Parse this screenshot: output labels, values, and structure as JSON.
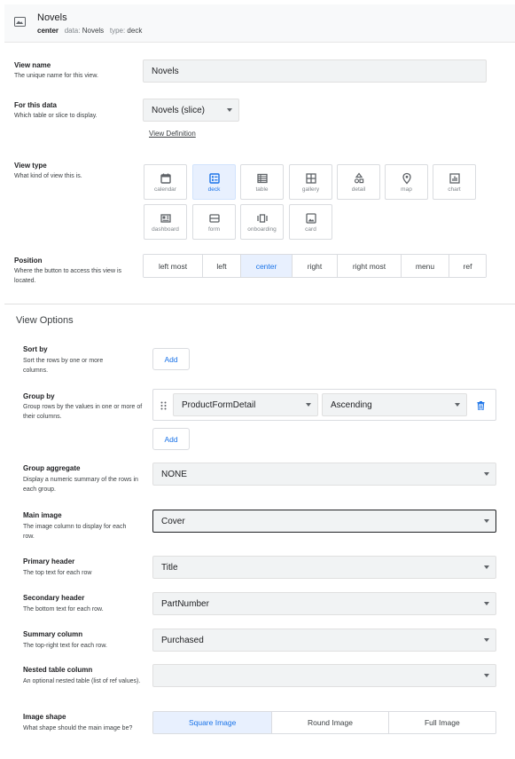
{
  "header": {
    "title": "Novels",
    "center_label": "center",
    "data_key": "data:",
    "data_value": "Novels",
    "type_key": "type:",
    "type_value": "deck"
  },
  "view_name": {
    "label": "View name",
    "desc": "The unique name for this view.",
    "value": "Novels"
  },
  "for_this_data": {
    "label": "For this data",
    "desc": "Which table or slice to display.",
    "value": "Novels (slice)",
    "link": "View Definition"
  },
  "view_type": {
    "label": "View type",
    "desc": "What kind of view this is.",
    "options": [
      "calendar",
      "deck",
      "table",
      "gallery",
      "detail",
      "map",
      "chart",
      "dashboard",
      "form",
      "onboarding",
      "card"
    ],
    "selected": "deck"
  },
  "position": {
    "label": "Position",
    "desc": "Where the button to access this view is located.",
    "options": [
      "left most",
      "left",
      "center",
      "right",
      "right most",
      "menu",
      "ref"
    ],
    "selected": "center"
  },
  "view_options": {
    "title": "View Options",
    "sort_by": {
      "label": "Sort by",
      "desc": "Sort the rows by one or more columns.",
      "button": "Add"
    },
    "group_by": {
      "label": "Group by",
      "desc": "Group rows by the values in one or more of their columns.",
      "column": "ProductFormDetail",
      "order": "Ascending",
      "button": "Add"
    },
    "group_aggregate": {
      "label": "Group aggregate",
      "desc": "Display a numeric summary of the rows in each group.",
      "value": "NONE"
    },
    "main_image": {
      "label": "Main image",
      "desc": "The image column to display for each row.",
      "value": "Cover"
    },
    "primary_header": {
      "label": "Primary header",
      "desc": "The top text for each row",
      "value": "Title"
    },
    "secondary_header": {
      "label": "Secondary header",
      "desc": "The bottom text for each row.",
      "value": "PartNumber"
    },
    "summary_column": {
      "label": "Summary column",
      "desc": "The top-right text for each row.",
      "value": "Purchased"
    },
    "nested_table_column": {
      "label": "Nested table column",
      "desc": "An optional nested table (list of ref values).",
      "value": ""
    },
    "image_shape": {
      "label": "Image shape",
      "desc": "What shape should the main image be?",
      "options": [
        "Square Image",
        "Round Image",
        "Full Image"
      ],
      "selected": "Square Image"
    }
  },
  "colors": {
    "accent": "#1a73e8",
    "selected_bg": "#e8f0fe",
    "field_bg": "#f1f3f4"
  }
}
